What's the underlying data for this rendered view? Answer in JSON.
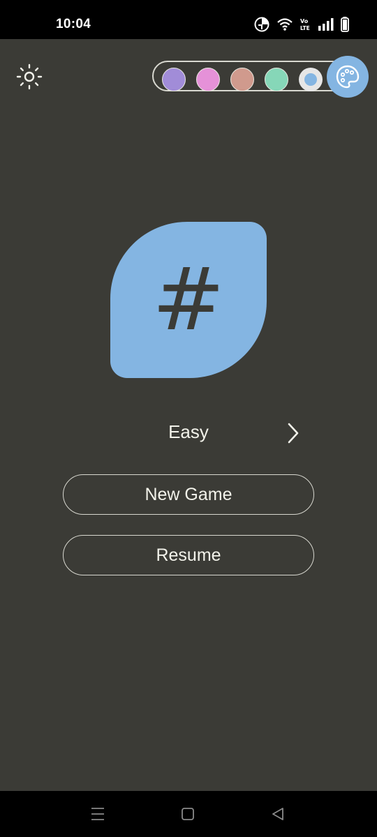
{
  "status_bar": {
    "time": "10:04",
    "icons": [
      "data-saver-icon",
      "wifi-icon",
      "volte-icon",
      "signal-icon",
      "battery-icon"
    ],
    "volte_text": "Vo LTE"
  },
  "theme": {
    "background": "#3b3b36",
    "accent": "#84b5e2",
    "text": "#f2f2ea"
  },
  "palette": {
    "swatches": [
      {
        "name": "purple",
        "color": "#a18cd8"
      },
      {
        "name": "pink",
        "color": "#e591d8"
      },
      {
        "name": "rose",
        "color": "#d09a8d"
      },
      {
        "name": "mint",
        "color": "#86d7b8"
      },
      {
        "name": "blue",
        "color": "#84b5e2",
        "selected": true
      }
    ]
  },
  "logo": {
    "symbol": "#"
  },
  "difficulty": {
    "label": "Easy"
  },
  "buttons": {
    "new_game": "New Game",
    "resume": "Resume"
  }
}
